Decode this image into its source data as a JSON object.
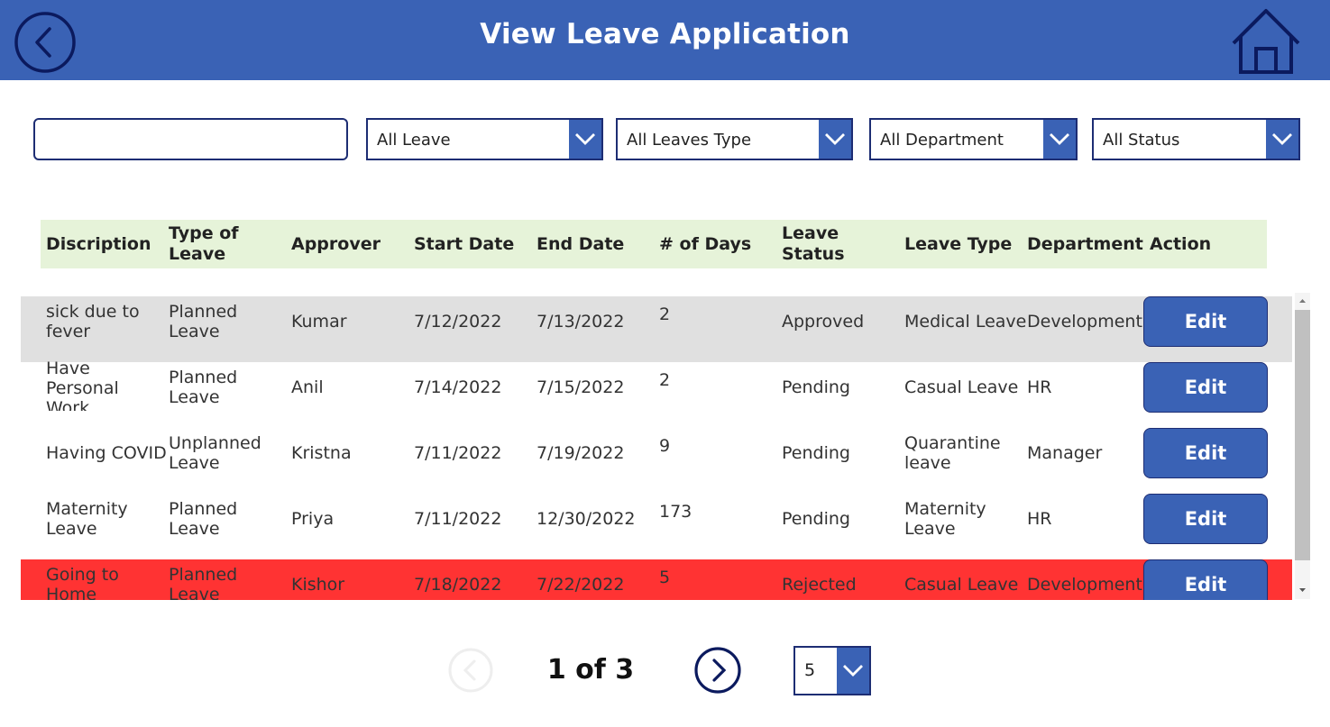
{
  "header": {
    "title": "View Leave Application"
  },
  "filters": {
    "search_value": "",
    "leave": "All Leave",
    "leave_type": "All Leaves Type",
    "department": "All Department",
    "status": "All Status"
  },
  "table": {
    "columns": [
      "Discription",
      "Type of Leave",
      "Approver",
      "Start Date",
      "End Date",
      "# of Days",
      "Leave Status",
      "Leave Type",
      "Department",
      "Action"
    ],
    "rows": [
      {
        "description": "sick due to fever",
        "type_of_leave": "Planned Leave",
        "approver": "Kumar",
        "start": "7/12/2022",
        "end": "7/13/2022",
        "days": "2",
        "status": "Approved",
        "leave_type": "Medical Leave",
        "department": "Development",
        "action": "Edit"
      },
      {
        "description": "Have Personal Work",
        "type_of_leave": "Planned Leave",
        "approver": "Anil",
        "start": "7/14/2022",
        "end": "7/15/2022",
        "days": "2",
        "status": "Pending",
        "leave_type": "Casual Leave",
        "department": "HR",
        "action": "Edit"
      },
      {
        "description": "Having COVID",
        "type_of_leave": "Unplanned Leave",
        "approver": "Kristna",
        "start": "7/11/2022",
        "end": "7/19/2022",
        "days": "9",
        "status": "Pending",
        "leave_type": "Quarantine leave",
        "department": "Manager",
        "action": "Edit"
      },
      {
        "description": "Maternity Leave",
        "type_of_leave": "Planned Leave",
        "approver": "Priya",
        "start": "7/11/2022",
        "end": "12/30/2022",
        "days": "173",
        "status": "Pending",
        "leave_type": "Maternity Leave",
        "department": "HR",
        "action": "Edit"
      },
      {
        "description": "Going to Home",
        "type_of_leave": "Planned Leave",
        "approver": "Kishor",
        "start": "7/18/2022",
        "end": "7/22/2022",
        "days": "5",
        "status": "Rejected",
        "leave_type": "Casual Leave",
        "department": "Development",
        "action": "Edit"
      }
    ]
  },
  "row_colors": {
    "selected": "#e0e0e0",
    "rejected": "#ff3333",
    "default": "#ffffff"
  },
  "pagination": {
    "page_info": "1 of 3",
    "page_size": "5"
  },
  "colors": {
    "header": "#3a62b5",
    "border": "#1d2d73",
    "table_header": "#e6f3d9"
  },
  "icons": [
    "back-arrow-icon",
    "home-icon",
    "chevron-down-icon",
    "chevron-left-icon",
    "chevron-right-icon"
  ]
}
